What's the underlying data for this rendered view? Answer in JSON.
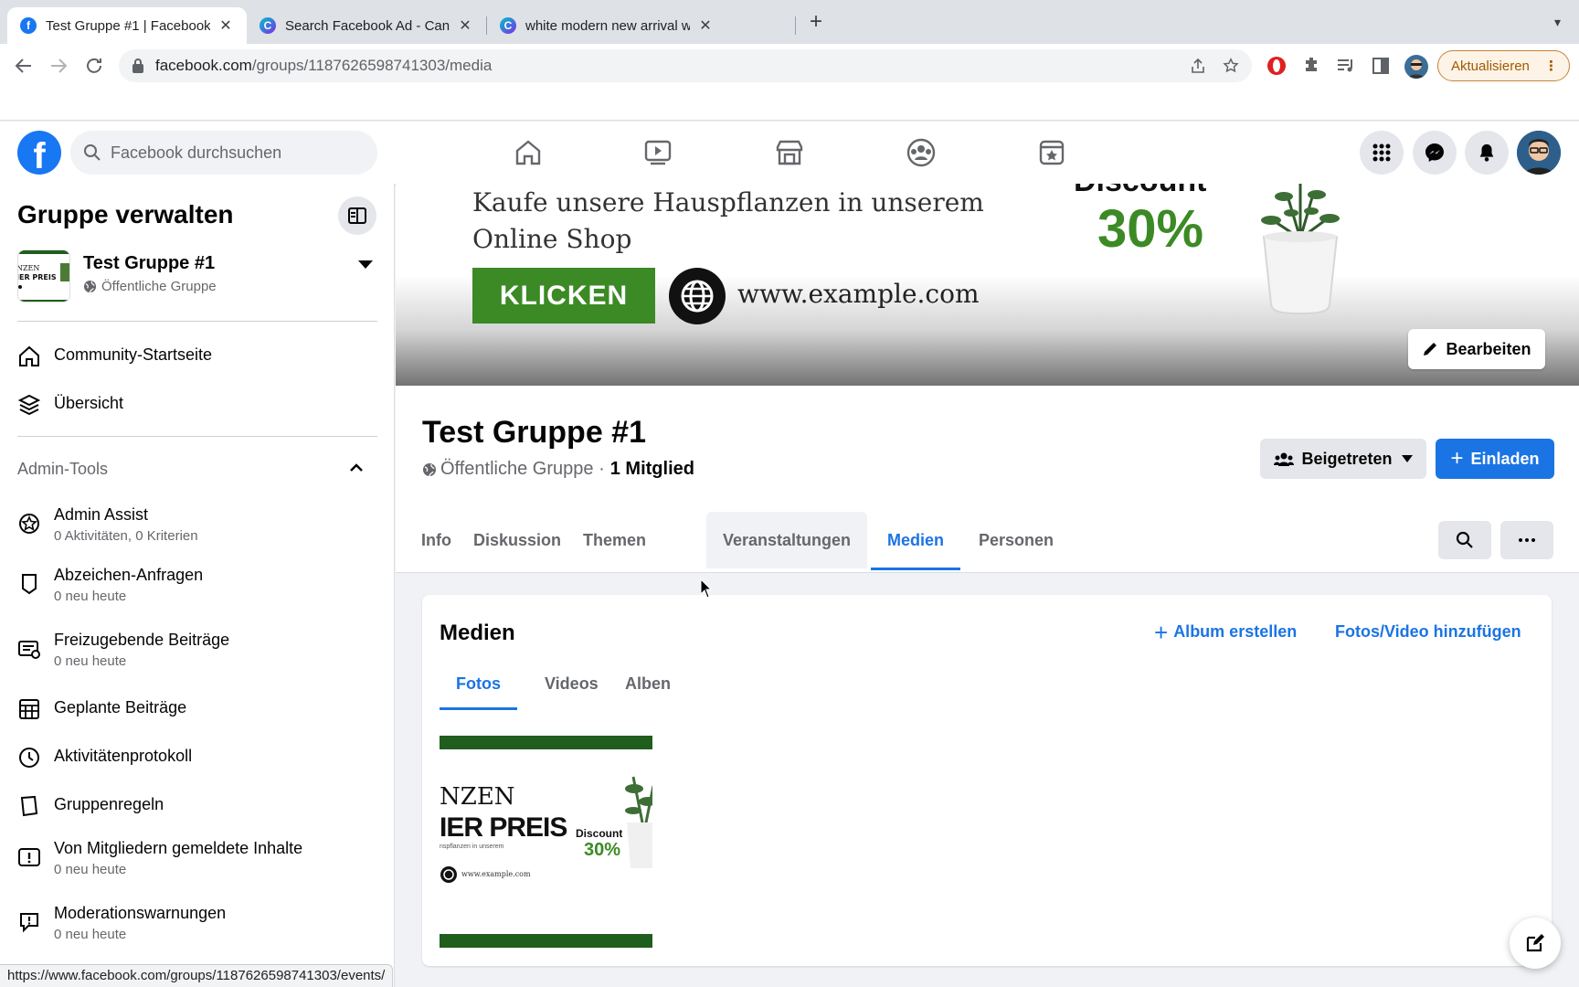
{
  "browser": {
    "tabs": [
      {
        "title": "Test Gruppe #1 | Facebook",
        "favicon": "facebook-icon"
      },
      {
        "title": "Search Facebook Ad - Canva",
        "favicon": "canva-icon"
      },
      {
        "title": "white modern new arrival watc",
        "favicon": "canva-icon"
      }
    ],
    "url_host": "facebook.com",
    "url_path": "/groups/1187626598741303/media",
    "update_label": "Aktualisieren"
  },
  "fb": {
    "search_placeholder": "Facebook durchsuchen",
    "brand_color": "#1877f2"
  },
  "sidebar": {
    "title": "Gruppe verwalten",
    "group_name": "Test Gruppe #1",
    "group_type": "Öffentliche Gruppe",
    "nav": [
      {
        "label": "Community-Startseite",
        "icon": "home-icon"
      },
      {
        "label": "Übersicht",
        "icon": "layers-icon"
      }
    ],
    "admin_tools_label": "Admin-Tools",
    "admin_items": [
      {
        "label": "Admin Assist",
        "sub": "0 Aktivitäten, 0 Kriterien",
        "icon": "admin-assist-icon"
      },
      {
        "label": "Abzeichen-Anfragen",
        "sub": "0 neu heute",
        "icon": "badge-icon"
      },
      {
        "label": "Freizugebende Beiträge",
        "sub": "0 neu heute",
        "icon": "pending-posts-icon"
      },
      {
        "label": "Geplante Beiträge",
        "sub": "",
        "icon": "calendar-icon"
      },
      {
        "label": "Aktivitätenprotokoll",
        "sub": "",
        "icon": "clock-icon"
      },
      {
        "label": "Gruppenregeln",
        "sub": "",
        "icon": "rules-icon"
      },
      {
        "label": "Von Mitgliedern gemeldete Inhalte",
        "sub": "0 neu heute",
        "icon": "report-icon"
      },
      {
        "label": "Moderationswarnungen",
        "sub": "0 neu heute",
        "icon": "warning-chat-icon"
      }
    ]
  },
  "cover": {
    "line1": "Kaufe unsere Hauspflanzen in unserem",
    "line2": "Online Shop",
    "cta": "KLICKEN",
    "website": "www.example.com",
    "discount_label": "Discount",
    "discount_value": "30%",
    "edit_label": "Bearbeiten"
  },
  "group": {
    "title": "Test Gruppe #1",
    "type": "Öffentliche Gruppe ·",
    "members": "1 Mitglied",
    "joined_label": "Beigetreten",
    "invite_label": "Einladen",
    "tabs": [
      "Info",
      "Diskussion",
      "Themen",
      "Veranstaltungen",
      "Medien",
      "Personen"
    ],
    "active_tab": "Medien",
    "hover_tab": "Veranstaltungen"
  },
  "media": {
    "title": "Medien",
    "create_album": "Album erstellen",
    "add_media": "Fotos/Video hinzufügen",
    "tabs": [
      "Fotos",
      "Videos",
      "Alben"
    ],
    "active_tab": "Fotos",
    "photo": {
      "line1": "NZEN",
      "line2": "IER PREIS",
      "line3": "nspflanzen in unserem",
      "discount_label": "Discount",
      "discount_value": "30%",
      "website": "www.example.com"
    }
  },
  "status_bar_url": "https://www.facebook.com/groups/1187626598741303/events/"
}
